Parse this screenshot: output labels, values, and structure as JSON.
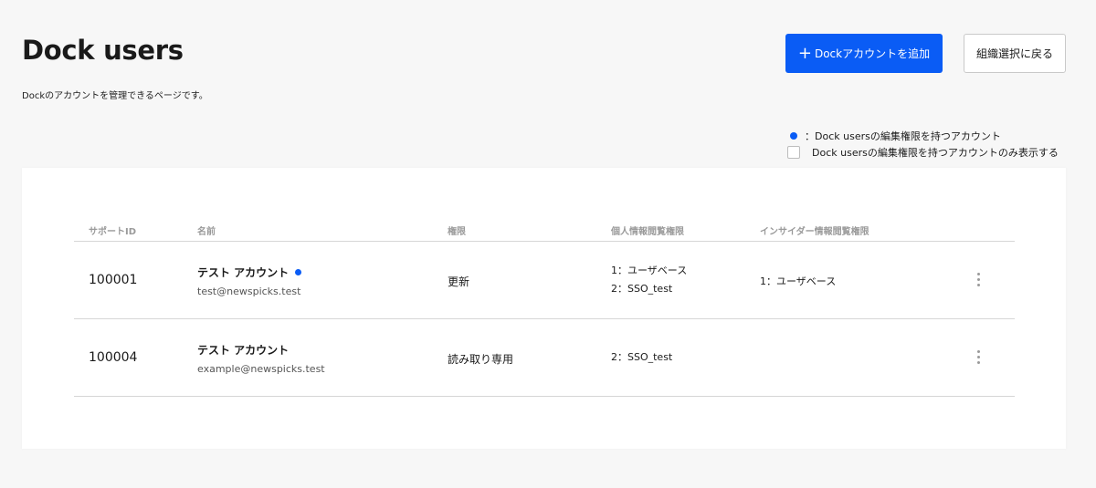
{
  "header": {
    "title": "Dock users",
    "subtitle": "Dockのアカウントを管理できるページです。",
    "add_button_plus": "+",
    "add_button_label": "Dockアカウントを追加",
    "back_button_label": "組織選択に戻る"
  },
  "legend": {
    "dot_color": "#0a5cf5",
    "text": "：Dock usersの編集権限を持つアカウント"
  },
  "filter": {
    "label": "Dock usersの編集権限を持つアカウントのみ表示する",
    "checked": false
  },
  "table": {
    "columns": [
      "サポートID",
      "名前",
      "権限",
      "個人情報閲覧権限",
      "インサイダー情報閲覧権限"
    ],
    "rows": [
      {
        "support_id": "100001",
        "name": "テスト アカウント",
        "has_edit_permission": true,
        "email": "test@newspicks.test",
        "permission": "更新",
        "personal_info": [
          "1：ユーザベース",
          "2：SSO_test"
        ],
        "insider_info": "1：ユーザベース"
      },
      {
        "support_id": "100004",
        "name": "テスト アカウント",
        "has_edit_permission": false,
        "email": "example@newspicks.test",
        "permission": "読み取り専用",
        "personal_info": [
          "2：SSO_test"
        ],
        "insider_info": ""
      }
    ]
  },
  "colors": {
    "accent": "#0a5cf5",
    "background": "#f7f7f7"
  }
}
